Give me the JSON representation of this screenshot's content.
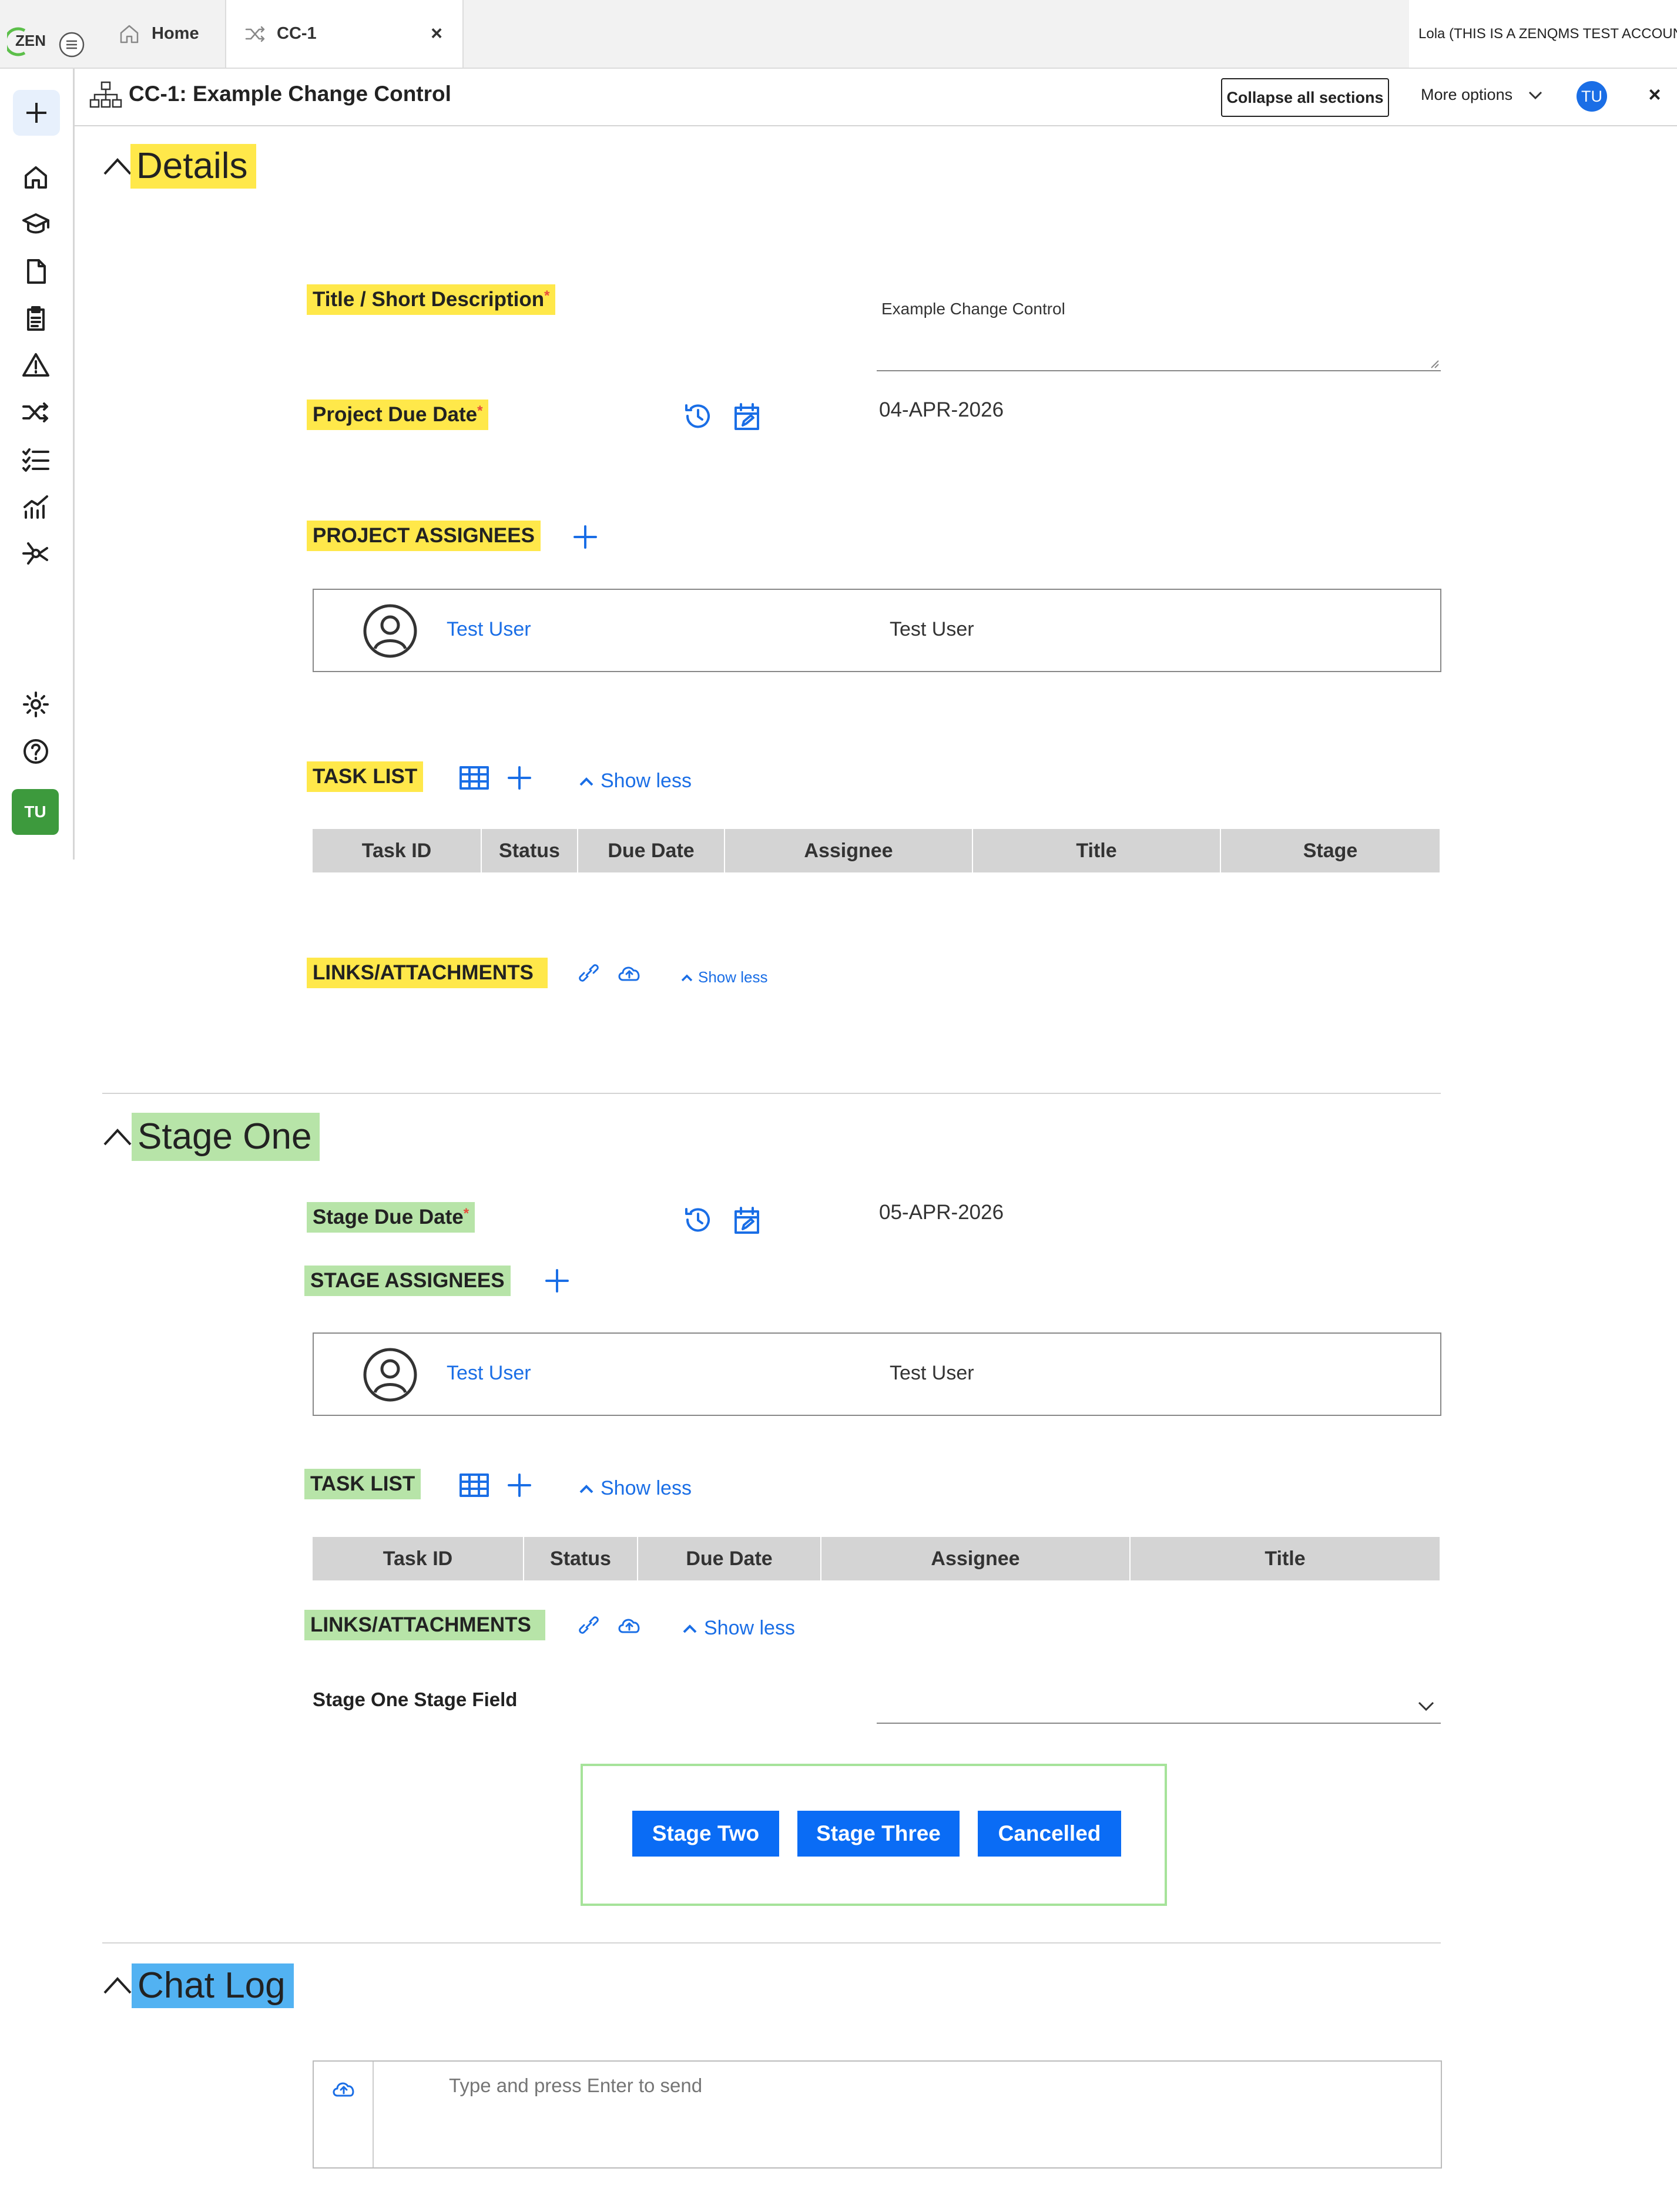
{
  "topbar": {
    "logo": "ZEN",
    "home_tab": "Home",
    "active_tab": "CC-1",
    "tab_close": "×",
    "account": "Lola (THIS IS A ZENQMS TEST ACCOUNT"
  },
  "sidebar": {
    "avatar": "TU",
    "icons": [
      "plus-icon",
      "home-icon",
      "graduation-cap-icon",
      "document-icon",
      "clipboard-icon",
      "warning-icon",
      "shuffle-icon",
      "checklist-icon",
      "analytics-icon",
      "network-icon",
      "gear-icon",
      "help-icon"
    ]
  },
  "header": {
    "title": "CC-1: Example Change Control",
    "collapse_label": "Collapse all sections",
    "more_options": "More options",
    "avatar": "TU",
    "close": "×"
  },
  "details": {
    "title": "Details",
    "title_label": "Title / Short Description",
    "title_value": "Example Change Control",
    "due_label": "Project Due Date",
    "due_value": "04-APR-2026",
    "assignees_label": "PROJECT ASSIGNEES",
    "assignee_link": "Test User",
    "assignee_name": "Test User",
    "task_list_label": "TASK LIST",
    "show_less": "Show less",
    "task_columns": [
      "Task ID",
      "Status",
      "Due Date",
      "Assignee",
      "Title",
      "Stage"
    ],
    "links_label": "LINKS/ATTACHMENTS",
    "links_show_less": "Show less"
  },
  "stage_one": {
    "title": "Stage One",
    "due_label": "Stage Due Date",
    "due_value": "05-APR-2026",
    "assignees_label": "STAGE ASSIGNEES",
    "assignee_link": "Test User",
    "assignee_name": "Test User",
    "task_list_label": "TASK LIST",
    "show_less": "Show less",
    "task_columns": [
      "Task ID",
      "Status",
      "Due Date",
      "Assignee",
      "Title"
    ],
    "links_label": "LINKS/ATTACHMENTS",
    "links_show_less": "Show less",
    "stage_field_label": "Stage One Stage Field",
    "buttons": [
      "Stage Two",
      "Stage Three",
      "Cancelled"
    ]
  },
  "chat_log": {
    "title": "Chat Log",
    "placeholder": "Type and press Enter to send"
  },
  "colors": {
    "accent": "#1a6ee6",
    "button": "#0a6cf5",
    "highlight_yellow": "#ffe84a",
    "highlight_green": "#b7e4a8",
    "highlight_blue": "#52b2f2",
    "required": "#e74c3c"
  }
}
